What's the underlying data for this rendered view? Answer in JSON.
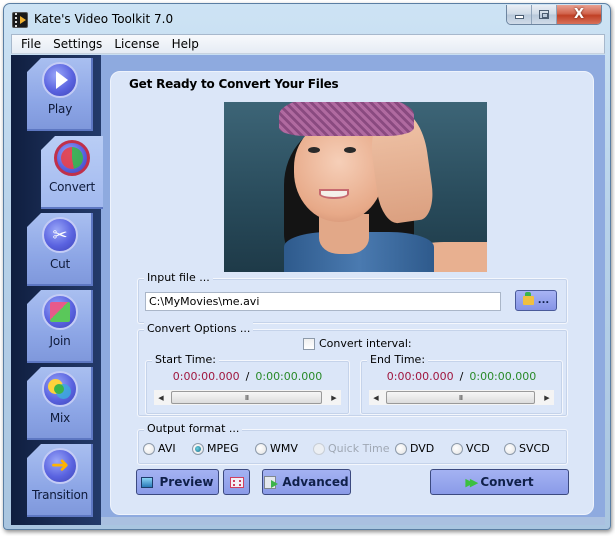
{
  "window": {
    "title": "Kate's Video Toolkit 7.0",
    "controls": {
      "minimize": "minimize",
      "maximize": "maximize",
      "close": "X"
    }
  },
  "menu": {
    "items": [
      "File",
      "Settings",
      "License",
      "Help"
    ]
  },
  "sidebar": {
    "items": [
      {
        "label": "Play",
        "icon": "play-icon",
        "active": false
      },
      {
        "label": "Convert",
        "icon": "convert-icon",
        "active": true
      },
      {
        "label": "Cut",
        "icon": "scissors-icon",
        "active": false
      },
      {
        "label": "Join",
        "icon": "join-icon",
        "active": false
      },
      {
        "label": "Mix",
        "icon": "mix-icon",
        "active": false
      },
      {
        "label": "Transition",
        "icon": "arrow-right-icon",
        "active": false
      }
    ]
  },
  "panel": {
    "title": "Get Ready to Convert Your Files",
    "preview_image": "video-frame-thumbnail",
    "input_file": {
      "label": "Input file ...",
      "value": "C:\\MyMovies\\me.avi",
      "browse_label": "..."
    },
    "convert_options": {
      "label": "Convert Options ...",
      "interval_checkbox_label": "Convert interval:",
      "interval_checked": false,
      "start_time": {
        "label": "Start Time:",
        "current": "0:00:00.000",
        "separator": "/",
        "total": "0:00:00.000"
      },
      "end_time": {
        "label": "End Time:",
        "current": "0:00:00.000",
        "separator": "/",
        "total": "0:00:00.000"
      },
      "scroll_thumb_glyph": "III",
      "scroll_left": "◀",
      "scroll_right": "▶"
    },
    "output_format": {
      "label": "Output format ...",
      "selected": "MPEG",
      "options": [
        {
          "label": "AVI",
          "enabled": true
        },
        {
          "label": "MPEG",
          "enabled": true
        },
        {
          "label": "WMV",
          "enabled": true
        },
        {
          "label": "Quick Time",
          "enabled": false
        },
        {
          "label": "DVD",
          "enabled": true
        },
        {
          "label": "VCD",
          "enabled": true
        },
        {
          "label": "SVCD",
          "enabled": true
        }
      ]
    },
    "buttons": {
      "preview": "Preview",
      "advanced": "Advanced",
      "convert": "Convert",
      "convert_icon_glyph": "▶▶"
    }
  },
  "colors": {
    "current_time": "#a01840",
    "total_time": "#2a8a2a",
    "panel_bg": "#dbe6f8",
    "sidebar_bg": "#1d305a",
    "button_bg": "#8a9be8"
  }
}
